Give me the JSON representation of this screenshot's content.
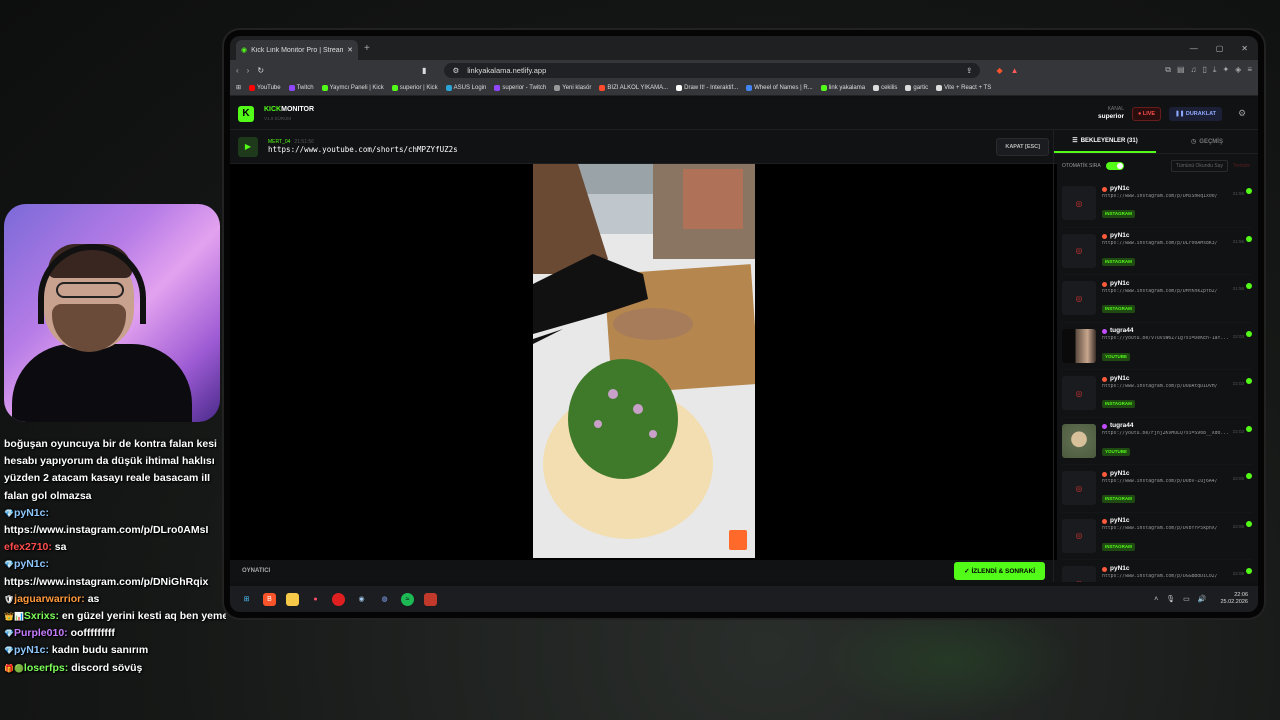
{
  "browser": {
    "tab_title": "Kick Link Monitor Pro | Stream D",
    "url": "linkyakalama.netlify.app",
    "bookmarks": [
      {
        "label": "YouTube",
        "color": "#ff0000"
      },
      {
        "label": "Twitch",
        "color": "#9146ff"
      },
      {
        "label": "Yaymcı Paneli | Kick",
        "color": "#53fc18"
      },
      {
        "label": "superior | Kick",
        "color": "#53fc18"
      },
      {
        "label": "ASUS Login",
        "color": "#2aa3d6"
      },
      {
        "label": "superior - Twitch",
        "color": "#9146ff"
      },
      {
        "label": "Yeni klasör",
        "color": "#999999"
      },
      {
        "label": "BIZI ALKOL YIKAMA...",
        "color": "#ff4b2b"
      },
      {
        "label": "Draw It! - Interaktif...",
        "color": "#ffffff"
      },
      {
        "label": "Wheel of Names | R...",
        "color": "#4285f4"
      },
      {
        "label": "link yakalama",
        "color": "#53fc18"
      },
      {
        "label": "cekilis",
        "color": "#dddddd"
      },
      {
        "label": "gartic",
        "color": "#dddddd"
      },
      {
        "label": "Vite + React + TS",
        "color": "#dddddd"
      }
    ]
  },
  "app": {
    "brand_kick": "KICK",
    "brand_monitor": "MONITOR",
    "version": "V1.0 SÜRÜM",
    "kanal_label": "KANAL",
    "kanal_name": "superior",
    "live": "LIVE",
    "pause": "DURAKLAT",
    "current": {
      "user": "MERT_04",
      "time": "21:51:56",
      "link": "https://www.youtube.com/shorts/chMPZYfUZ2s"
    },
    "close": "KAPAT [ESC]",
    "player_label": "OYNATICI",
    "next_button": "İZLENDİ & SONRAKİ",
    "tab_waiting": "BEKLEYENLER (31)",
    "tab_history": "GEÇMİŞ",
    "auto_label": "OTOMATİK SIRA",
    "mark_all": "Tümünü Okundu Say",
    "clear": "Temizle",
    "queue": [
      {
        "user": "pyN1c",
        "link": "https://www.instagram.com/p/DMiShRq1x00/",
        "tag": "INSTAGRAM",
        "time": "21:55",
        "dot": "#ff5a3c",
        "thumb": ""
      },
      {
        "user": "pyN1c",
        "link": "https://www.instagram.com/p/DLro0AMs8K3/",
        "tag": "INSTAGRAM",
        "time": "21:56",
        "dot": "#ff5a3c",
        "thumb": ""
      },
      {
        "user": "pyN1c",
        "link": "https://www.instagram.com/p/DMYKnkZpfb2/",
        "tag": "INSTAGRAM",
        "time": "21:56",
        "dot": "#ff5a3c",
        "thumb": ""
      },
      {
        "user": "tugra44",
        "link": "https://youtu.be/v7uviW6Z71g?si=DeKEn-1aY...",
        "tag": "YOUTUBE",
        "time": "22:03",
        "dot": "#c34cff",
        "thumb": "img1"
      },
      {
        "user": "pyN1c",
        "link": "https://www.instagram.com/p/DODAtqDIDvH/",
        "tag": "INSTAGRAM",
        "time": "22:03",
        "dot": "#ff5a3c",
        "thumb": ""
      },
      {
        "user": "tugra44",
        "link": "https://youtu.be/Fjnj2KvMULQ?si=S908__Xd0...",
        "tag": "YOUTUBE",
        "time": "22:03",
        "dot": "#c34cff",
        "thumb": "img2"
      },
      {
        "user": "pyN1c",
        "link": "https://www.instagram.com/p/DObv-Zuj6A4/",
        "tag": "INSTAGRAM",
        "time": "22:05",
        "dot": "#ff5a3c",
        "thumb": ""
      },
      {
        "user": "pyN1c",
        "link": "https://www.instagram.com/p/DVbYYP5kpnX/",
        "tag": "INSTAGRAM",
        "time": "22:06",
        "dot": "#ff5a3c",
        "thumb": ""
      },
      {
        "user": "pyN1c",
        "link": "https://www.instagram.com/p/DGGBBdDiC02/",
        "tag": "INSTAGRAM",
        "time": "22:06",
        "dot": "#ff5a3c",
        "thumb": ""
      }
    ]
  },
  "taskbar": {
    "time": "22:06",
    "date": "25.02.2026"
  },
  "chat": [
    {
      "name": "",
      "text": "boğuşan oyuncuya bir de kontra falan kesi",
      "color": "#ffffff"
    },
    {
      "name": "",
      "text": "hesabı yapıyorum da düşük ihtimal haklısı",
      "color": "#ffffff"
    },
    {
      "name": "",
      "text": "yüzden 2 atacam kasayı reale basacam iII",
      "color": "#ffffff"
    },
    {
      "name": "",
      "text": "falan gol olmazsa",
      "color": "#ffffff"
    },
    {
      "name": "pyN1c:",
      "text": "",
      "color": "#8ec8ff",
      "badge": "💎"
    },
    {
      "name": "",
      "text": "https://www.instagram.com/p/DLro0AMsI",
      "color": "#ffffff"
    },
    {
      "name": "efex2710:",
      "text": "sa",
      "color": "#ff4d4d"
    },
    {
      "name": "pyN1c:",
      "text": "",
      "color": "#8ec8ff",
      "badge": "💎"
    },
    {
      "name": "",
      "text": "https://www.instagram.com/p/DNiGhRqix",
      "color": "#ffffff"
    },
    {
      "name": "jaguarwarrior:",
      "text": "as",
      "color": "#ff9a3c",
      "badge": "🛡"
    },
    {
      "name": "Sxrixs:",
      "text": "en güzel yerini kesti aq ben yemem",
      "color": "#7dff5a",
      "badge": "👑📊"
    },
    {
      "name": "Purple010:",
      "text": "oofffffffff",
      "color": "#c77dff",
      "badge": "💎"
    },
    {
      "name": "pyN1c:",
      "text": "kadın budu sanırım",
      "color": "#8ec8ff",
      "badge": "💎"
    },
    {
      "name": "loserfps:",
      "text": "discord sövüş",
      "color": "#7dff5a",
      "badge": "🎁🟢"
    }
  ]
}
